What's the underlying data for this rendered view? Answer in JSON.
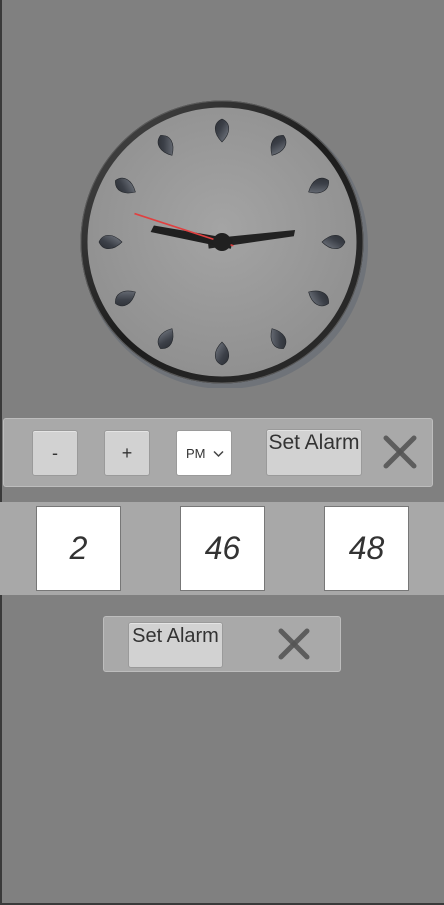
{
  "controls": {
    "minus_label": "-",
    "plus_label": "+",
    "period_value": "PM",
    "set_alarm_label": "Set Alarm"
  },
  "time": {
    "hours": "2",
    "minutes": "46",
    "seconds": "48"
  },
  "alarm": {
    "set_alarm_label": "Set Alarm"
  },
  "clock": {
    "hour": 2,
    "minute": 46,
    "second": 48
  },
  "colors": {
    "background": "#808080",
    "panel": "#a9a9a9",
    "second_hand": "#e04040",
    "hands": "#222222",
    "close_icon": "#5a5a5a"
  },
  "icons": {
    "close": "close-icon",
    "dropdown": "chevron-down-icon"
  }
}
